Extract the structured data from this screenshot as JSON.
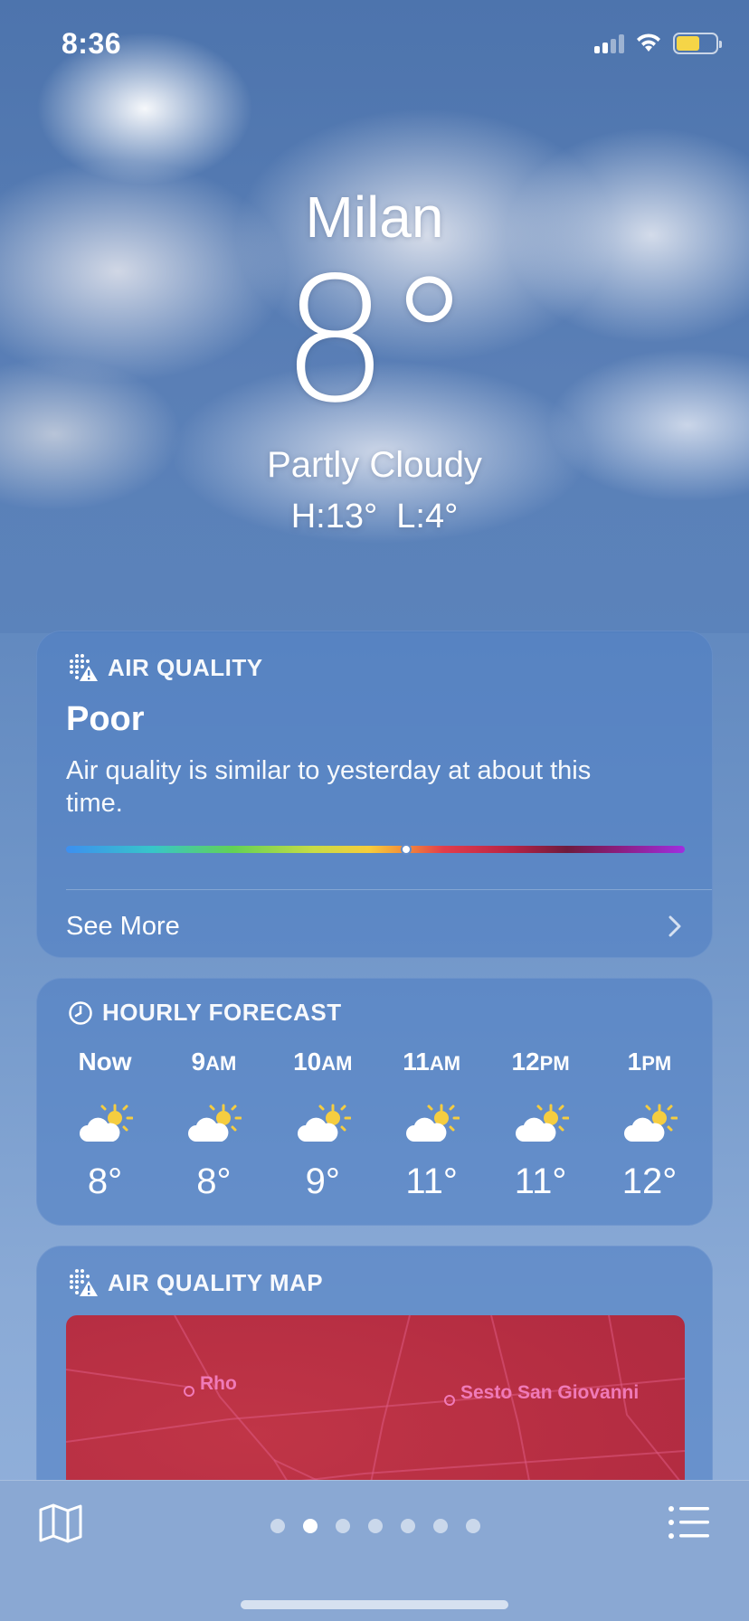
{
  "status_bar": {
    "time": "8:36",
    "battery_color": "#f5d547"
  },
  "weather": {
    "city": "Milan",
    "temperature": "8°",
    "condition": "Partly Cloudy",
    "high_low": "H:13°  L:4°"
  },
  "air_quality": {
    "title": "AIR QUALITY",
    "icon": "air-quality-icon",
    "level": "Poor",
    "description": "Air quality is similar to yesterday at about this time.",
    "scale_position": 0.55,
    "see_more": "See More"
  },
  "hourly": {
    "title": "HOURLY FORECAST",
    "icon": "clock-icon",
    "hours": [
      {
        "main": "Now",
        "suffix": "",
        "temp": "8°",
        "icon": "partly-cloudy-icon"
      },
      {
        "main": "9",
        "suffix": "AM",
        "temp": "8°",
        "icon": "partly-cloudy-icon"
      },
      {
        "main": "10",
        "suffix": "AM",
        "temp": "9°",
        "icon": "partly-cloudy-icon"
      },
      {
        "main": "11",
        "suffix": "AM",
        "temp": "11°",
        "icon": "partly-cloudy-icon"
      },
      {
        "main": "12",
        "suffix": "PM",
        "temp": "11°",
        "icon": "partly-cloudy-icon"
      },
      {
        "main": "1",
        "suffix": "PM",
        "temp": "12°",
        "icon": "partly-cloudy-icon"
      }
    ]
  },
  "air_quality_map": {
    "title": "AIR QUALITY MAP",
    "labels": [
      "Rho",
      "Sesto San Giovanni"
    ]
  },
  "bottom_bar": {
    "page_count": 7,
    "active_page": 2
  }
}
